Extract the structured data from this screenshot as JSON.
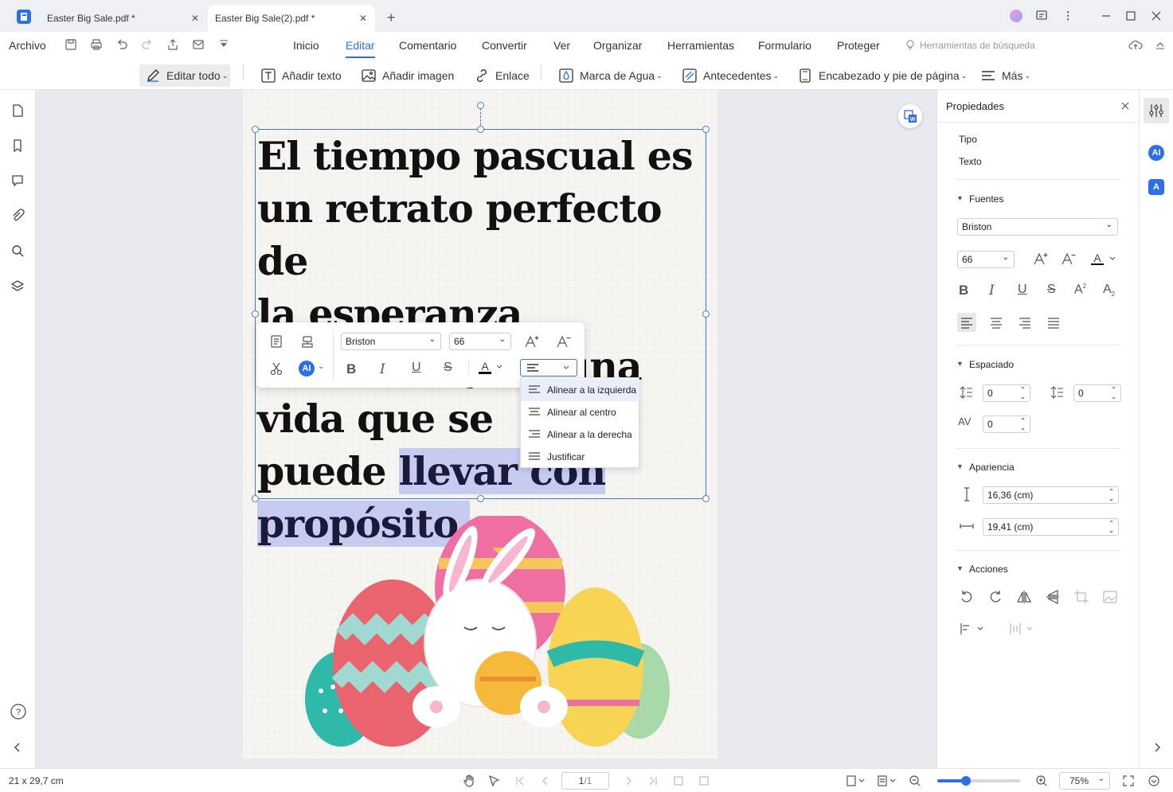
{
  "tabs": [
    {
      "label": "Easter Big Sale.pdf *",
      "active": false
    },
    {
      "label": "Easter Big Sale(2).pdf *",
      "active": true
    }
  ],
  "menubar": {
    "file": "Archivo",
    "items": [
      "Inicio",
      "Editar",
      "Comentario",
      "Convertir",
      "Ver",
      "Organizar",
      "Herramientas",
      "Formulario",
      "Proteger"
    ],
    "active": "Editar",
    "search_tools": "Herramientas de búsqueda"
  },
  "toolbar": {
    "edit_all": "Editar todo",
    "add_text": "Añadir texto",
    "add_image": "Añadir imagen",
    "link": "Enlace",
    "watermark": "Marca de Agua",
    "background": "Antecedentes",
    "header_footer": "Encabezado y pie de página",
    "more": "Más"
  },
  "document": {
    "lines": [
      "El tiempo pascual es",
      "un retrato perfecto de",
      "la esperanza",
      "renovada y de una",
      "vida que se"
    ],
    "line6_plain": "puede ",
    "line6_highlight": "llevar con",
    "line7_highlight": "propósito."
  },
  "float_toolbar": {
    "font": "Briston",
    "size": "66"
  },
  "align_menu": {
    "items": [
      "Alinear a la izquierda",
      "Alinear al centro",
      "Alinear a la derecha",
      "Justificar"
    ],
    "selected_index": 0
  },
  "properties": {
    "title": "Propiedades",
    "type_label": "Tipo",
    "type_value": "Texto",
    "fonts_label": "Fuentes",
    "font": "Briston",
    "size": "66",
    "spacing_label": "Espaciado",
    "line_spacing": "0",
    "para_spacing": "0",
    "char_spacing": "0",
    "appearance_label": "Apariencia",
    "height": "16,36 (cm)",
    "width": "19,41 (cm)",
    "actions_label": "Acciones"
  },
  "status": {
    "page_size": "21 x 29,7 cm",
    "page": "1",
    "total": "/1",
    "zoom": "75%",
    "zoom_fraction": 0.35
  },
  "colors": {
    "accent": "#2d6fe8",
    "selection": "#3b7bdb",
    "highlight": "#c8cbf0"
  }
}
